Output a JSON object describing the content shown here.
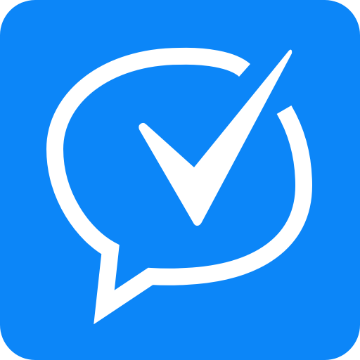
{
  "icon": {
    "name": "chat-bubble-checkmark-icon",
    "background_color": "#0C86F8",
    "foreground_color": "#FFFFFF"
  }
}
